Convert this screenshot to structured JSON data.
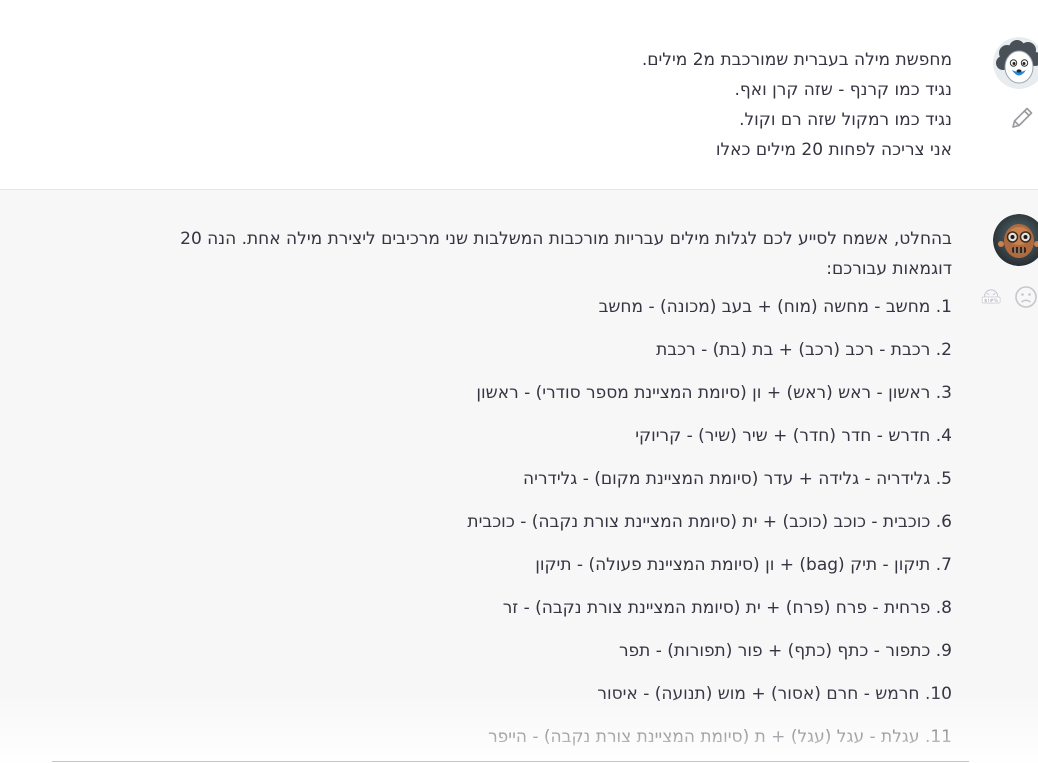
{
  "user_message": {
    "avatar_icon": "sheep-avatar-icon",
    "edit_icon": "pencil-icon",
    "lines": [
      "מחפשת מילה בעברית שמורכבת מ2 מילים.",
      "נגיד כמו קרנף - שזה קרן ואף.",
      "נגיד כמו רמקול שזה רם וקול.",
      "אני צריכה לפחות 20 מילים כאלו"
    ]
  },
  "assistant_message": {
    "avatar_icon": "robot-avatar-icon",
    "rating_icons": [
      "angry-face-icon",
      "sad-face-icon"
    ],
    "intro": "בהחלט, אשמח לסייע לכם לגלות מילים עבריות מורכבות המשלבות שני מרכיבים ליצירת מילה אחת. הנה 20 דוגמאות עבורכם:",
    "items": [
      "1. מחשב - מחשה (מוח) + בעב (מכונה) - מחשב",
      "2. רכבת - רכב (רכב) + בת (בת) - רכבת",
      "3. ראשון - ראש (ראש) + ון (סיומת המציינת מספר סודרי) - ראשון",
      "4. חדרש - חדר (חדר) + שיר (שיר) - קריוקי",
      "5. גלידריה - גלידה + עדר (סיומת המציינת מקום) - גלידריה",
      "6. כוכבית - כוכב (כוכב) + ית (סיומת המציינת צורת נקבה) - כוכבית",
      "7. תיקון - תיק (bag) + ון (סיומת המציינת פעולה) - תיקון",
      "8. פרחית - פרח (פרח) + ית (סיומת המציינת צורת נקבה) - זר",
      "9. כתפור - כתף (כתף) + פור (תפורות) - תפר",
      "10. חרמש - חרם (אסור) + מוש (תנועה) - איסור",
      "11. עגלת - עגל (עגל) + ת (סיומת המציינת צורת נקבה) - הייפר"
    ]
  }
}
